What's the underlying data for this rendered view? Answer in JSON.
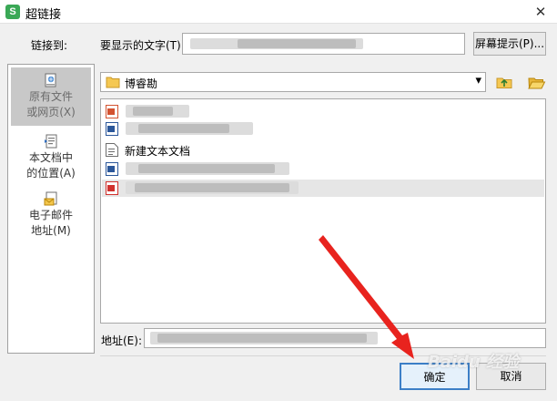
{
  "window": {
    "app_icon_letter": "S",
    "title": "超链接",
    "close_glyph": "✕"
  },
  "form": {
    "link_to_label": "链接到:",
    "display_text_label": "要显示的文字(T)",
    "display_text_value": "",
    "screentip_button": "屏幕提示(P)...",
    "address_label": "地址(E):",
    "address_value": ""
  },
  "nav": {
    "items": [
      {
        "icon": "existing-file-icon",
        "label_line1": "原有文件",
        "label_line2": "或网页(X)"
      },
      {
        "icon": "document-position-icon",
        "label_line1": "本文档中",
        "label_line2": "的位置(A)"
      },
      {
        "icon": "email-address-icon",
        "label_line1": "电子邮件",
        "label_line2": "地址(M)"
      }
    ]
  },
  "browser": {
    "current_folder": "博睿勘",
    "dropdown_glyph": "▾",
    "files": [
      {
        "type": "ppt",
        "name": ""
      },
      {
        "type": "word",
        "name": ""
      },
      {
        "type": "text",
        "name": "新建文本文档"
      },
      {
        "type": "word",
        "name": ""
      },
      {
        "type": "pdf",
        "name": ""
      }
    ]
  },
  "buttons": {
    "ok": "确定",
    "cancel": "取消"
  },
  "annotation": {
    "arrow_color": "#e8231e"
  },
  "watermark": {
    "text": "Baidu 经验"
  }
}
